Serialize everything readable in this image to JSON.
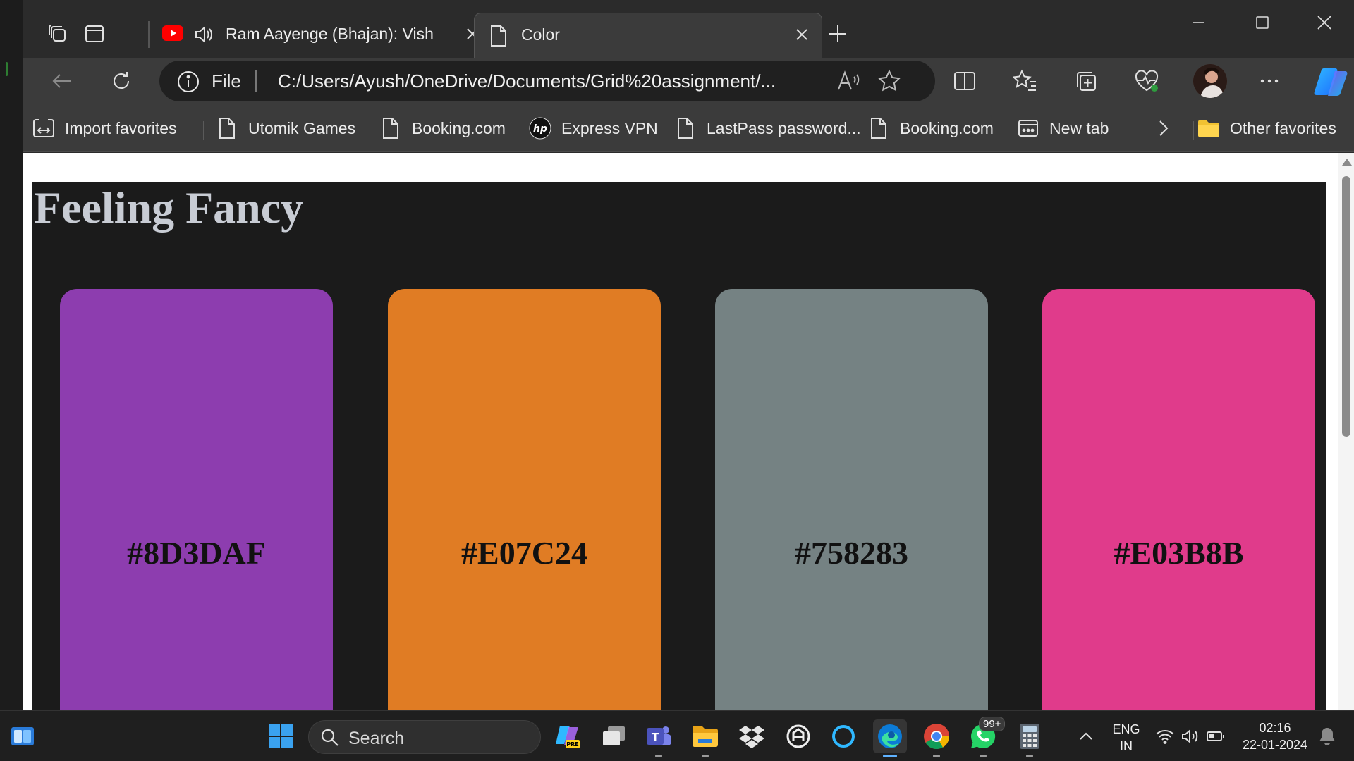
{
  "browser": {
    "tabs": [
      {
        "title": "Ram Aayenge (Bhajan): Vish",
        "state": "inactive",
        "icon": "youtube-icon",
        "audio": true
      },
      {
        "title": "Color",
        "state": "active",
        "icon": "file-icon"
      }
    ],
    "address": {
      "scheme_label": "File",
      "url": "C:/Users/Ayush/OneDrive/Documents/Grid%20assignment/..."
    },
    "favorites": [
      {
        "label": "Import favorites",
        "icon": "import-icon"
      },
      {
        "label": "Utomik Games",
        "icon": "page-icon"
      },
      {
        "label": "Booking.com",
        "icon": "page-icon"
      },
      {
        "label": "Express VPN",
        "icon": "hp-icon"
      },
      {
        "label": "LastPass password...",
        "icon": "page-icon"
      },
      {
        "label": "Booking.com",
        "icon": "page-icon"
      },
      {
        "label": "New tab",
        "icon": "newtab-icon"
      },
      {
        "label": "Other favorites",
        "icon": "folder-icon"
      }
    ]
  },
  "page": {
    "heading": "Feeling Fancy",
    "cards": [
      {
        "label": "#8D3DAF",
        "color": "#8D3DAF"
      },
      {
        "label": "#E07C24",
        "color": "#E07C24"
      },
      {
        "label": "#758283",
        "color": "#758283"
      },
      {
        "label": "#E03B8B",
        "color": "#E03B8B"
      }
    ]
  },
  "taskbar": {
    "search_label": "Search",
    "language": "ENG",
    "region": "IN",
    "time": "02:16",
    "date": "22-01-2024",
    "whatsapp_badge": "99+"
  }
}
